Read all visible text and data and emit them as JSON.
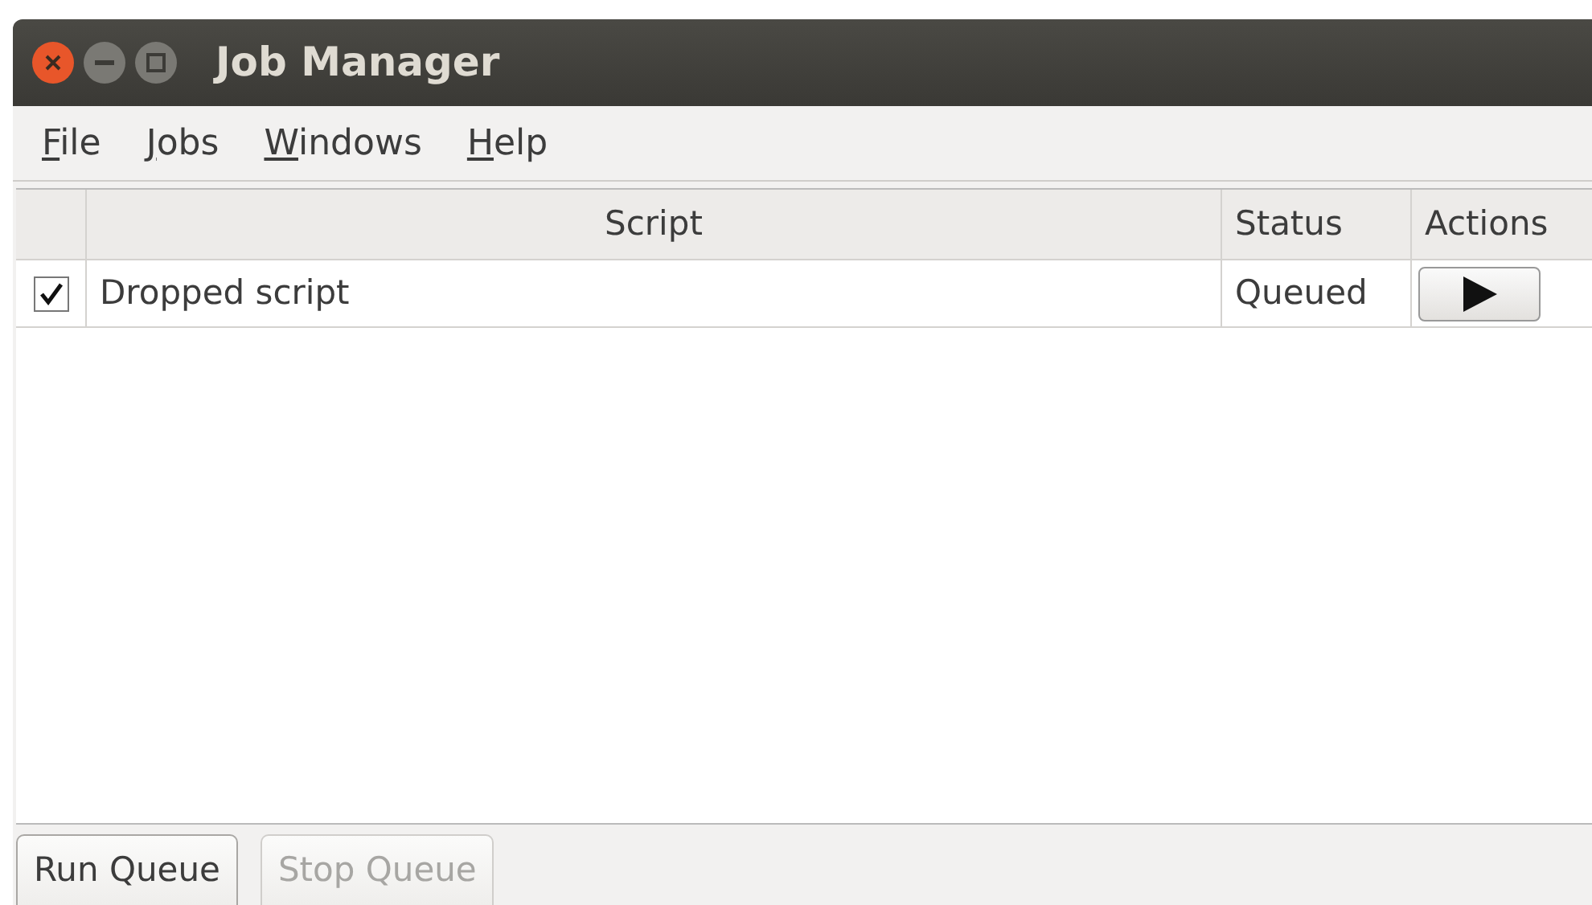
{
  "window": {
    "title": "Job Manager"
  },
  "menu": [
    {
      "label": "File"
    },
    {
      "label": "Jobs"
    },
    {
      "label": "Windows"
    },
    {
      "label": "Help"
    }
  ],
  "table": {
    "columns": [
      "Script",
      "Status",
      "Actions"
    ],
    "rows": [
      {
        "checked": true,
        "script": "Dropped script",
        "status": "Queued"
      }
    ]
  },
  "buttons": [
    {
      "label": "Run Queue",
      "disabled": false
    },
    {
      "label": "Stop Queue",
      "disabled": true
    }
  ]
}
